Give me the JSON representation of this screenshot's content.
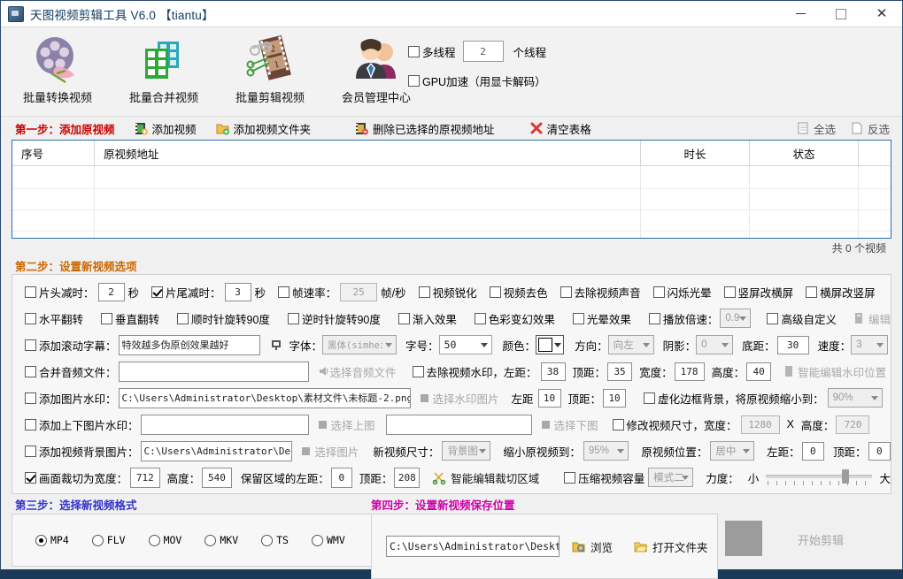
{
  "window": {
    "title": "天图视频剪辑工具 V6.0  【tiantu】",
    "minimize": "—",
    "maximize": "□",
    "close": "✕"
  },
  "toolbar": {
    "items": [
      {
        "label": "批量转换视频",
        "icon": "film-reel-icon"
      },
      {
        "label": "批量合并视频",
        "icon": "merge-blocks-icon"
      },
      {
        "label": "批量剪辑视频",
        "icon": "film-scissors-icon"
      },
      {
        "label": "会员管理中心",
        "icon": "members-icon"
      }
    ],
    "multithread_label": "多线程",
    "multithread_count": "2",
    "multithread_suffix": "个线程",
    "gpu_label": "GPU加速（用显卡解码）"
  },
  "step1": {
    "title": "第一步：添加原视频",
    "add_video": "添加视频",
    "add_folder": "添加视频文件夹",
    "delete_selected": "删除已选择的原视频地址",
    "clear_table": "清空表格",
    "select_all": "全选",
    "invert_select": "反选"
  },
  "table": {
    "headers": [
      "序号",
      "原视频地址",
      "时长",
      "状态"
    ],
    "rows": [],
    "count_text": "共 0 个视频"
  },
  "step2": {
    "title": "第二步：设置新视频选项",
    "row1": {
      "head_trim_label": "片头减时：",
      "head_trim_value": "2",
      "head_trim_unit": "秒",
      "tail_trim_label": "片尾减时：",
      "tail_trim_value": "3",
      "tail_trim_unit": "秒",
      "framerate_label": "帧速率：",
      "framerate_value": "25",
      "framerate_unit": "帧/秒",
      "sharpen": "视频锐化",
      "decolor": "视频去色",
      "mute": "去除视频声音",
      "flicker": "闪烁光晕",
      "portrait_to_landscape": "竖屏改横屏",
      "landscape_to_portrait": "横屏改竖屏"
    },
    "row2": {
      "hflip": "水平翻转",
      "vflip": "垂直翻转",
      "rotate_cw": "顺时针旋转90度",
      "rotate_ccw": "逆时针旋转90度",
      "fade_in": "渐入效果",
      "color_shift": "色彩变幻效果",
      "halo": "光晕效果",
      "speed_label": "播放倍速：",
      "speed_value": "0.9",
      "advanced": "高级自定义",
      "edit_btn": "编辑"
    },
    "row3": {
      "scroll_subtitle": "添加滚动字幕：",
      "subtitle_text": "特效越多伪原创效果越好",
      "font_label": "字体：",
      "font_value": "黑体(simhei)",
      "size_label": "字号：",
      "size_value": "50",
      "color_label": "颜色：",
      "color_value": "#ffffff",
      "direction_label": "方向：",
      "direction_value": "向左",
      "shadow_label": "阴影：",
      "shadow_value": "0",
      "bottom_label": "底距：",
      "bottom_value": "30",
      "speed_label": "速度：",
      "speed_value": "3"
    },
    "row4": {
      "merge_audio": "合并音频文件：",
      "merge_audio_value": "",
      "choose_audio": "选择音频文件",
      "remove_watermark": "去除视频水印，左距：",
      "wm_left": "38",
      "wm_top_label": "顶距：",
      "wm_top": "35",
      "wm_width_label": "宽度：",
      "wm_width": "178",
      "wm_height_label": "高度：",
      "wm_height": "40",
      "smart_edit_wm": "智能编辑水印位置"
    },
    "row5": {
      "add_img_watermark": "添加图片水印：",
      "img_wm_path": "C:\\Users\\Administrator\\Desktop\\素材文件\\未标题-2.png",
      "choose_wm_img": "选择水印图片",
      "left_label": "左距",
      "left_value": "10",
      "top_label": "顶距：",
      "top_value": "10",
      "blur_border": "虚化边框背景，将原视频缩小到：",
      "blur_value": "90%"
    },
    "row6": {
      "add_tb_watermark": "添加上下图片水印：",
      "top_img_value": "",
      "choose_top": "选择上图",
      "bottom_img_value": "",
      "choose_bottom": "选择下图",
      "resize_label": "修改视频尺寸，宽度：",
      "resize_w": "1280",
      "times": "X",
      "resize_h_label": "高度：",
      "resize_h": "720"
    },
    "row7": {
      "add_bg_image": "添加视频背景图片：",
      "bg_path": "C:\\Users\\Administrator\\Desktop\\d",
      "choose_img": "选择图片",
      "new_size_label": "新视频尺寸：",
      "new_size_value": "背景图",
      "shrink_label": "缩小原视频到：",
      "shrink_value": "95%",
      "pos_label": "原视频位置：",
      "pos_value": "居中",
      "left_label": "左距：",
      "left_value": "0",
      "top_label": "顶距：",
      "top_value": "0"
    },
    "row8": {
      "crop_label": "画面裁切为宽度：",
      "crop_w": "712",
      "crop_h_label": "高度：",
      "crop_h": "540",
      "keep_left_label": "保留区域的左距：",
      "keep_left": "0",
      "keep_top_label": "顶距：",
      "keep_top": "208",
      "smart_crop": "智能编辑裁切区域",
      "compress": "压缩视频容量",
      "compress_mode": "模式二",
      "strength_label": "力度：",
      "strength_min": "小",
      "strength_max": "大"
    }
  },
  "step3": {
    "title": "第三步：选择新视频格式",
    "formats": [
      "MP4",
      "FLV",
      "MOV",
      "MKV",
      "TS",
      "WMV"
    ],
    "selected": "MP4"
  },
  "step4": {
    "title": "第四步：设置新视频保存位置",
    "save_path": "C:\\Users\\Administrator\\Desktop",
    "browse": "浏览",
    "open_folder": "打开文件夹",
    "start": "开始剪辑"
  },
  "colors": {
    "step1": "#cc0000",
    "step2": "#cc6600",
    "step3": "#3333cc",
    "step4": "#cc00aa",
    "table_border": "#2f6fae",
    "title_text": "#123a63"
  }
}
